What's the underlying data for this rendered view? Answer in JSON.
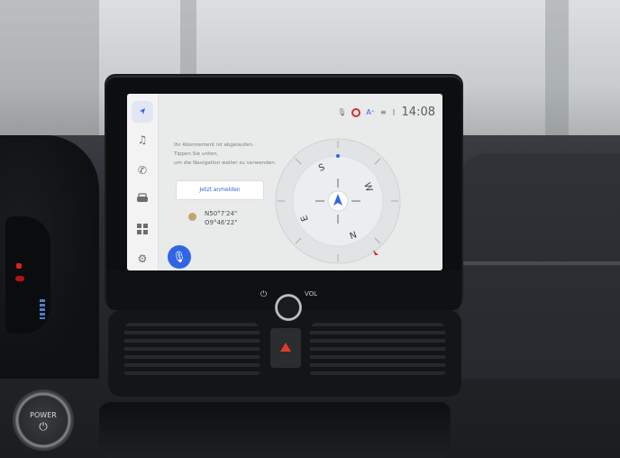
{
  "statusbar": {
    "time": "14:08",
    "icons": [
      "microphone-icon",
      "recording-icon",
      "accessibility-icon",
      "signal-icon",
      "bluetooth-icon"
    ]
  },
  "sidebar": {
    "items": [
      {
        "icon": "navigation-arrow-icon",
        "active": true
      },
      {
        "icon": "music-note-icon"
      },
      {
        "icon": "phone-icon"
      },
      {
        "icon": "car-icon"
      },
      {
        "icon": "apps-grid-icon"
      },
      {
        "icon": "settings-gear-icon"
      }
    ],
    "mic_icon": "microphone-icon"
  },
  "message": {
    "line1": "Ihr Abonnement ist abgelaufen.",
    "line2": "Tippen Sie unten,",
    "line3": "um die Navigation weiter zu verwenden."
  },
  "login_button": "Jetzt anmelden",
  "coordinates": {
    "lat": "N50°7'24\"",
    "lon": "O9°46'22\""
  },
  "compass": {
    "labels": [
      "S",
      "W",
      "N",
      "E"
    ]
  },
  "hardware": {
    "vol_label": "VOL",
    "power_symbol": "⏻",
    "power_button_label": "POWER"
  },
  "colors": {
    "accent": "#3265e6",
    "screen_bg": "#e9eaea",
    "north_marker": "#d03030"
  }
}
